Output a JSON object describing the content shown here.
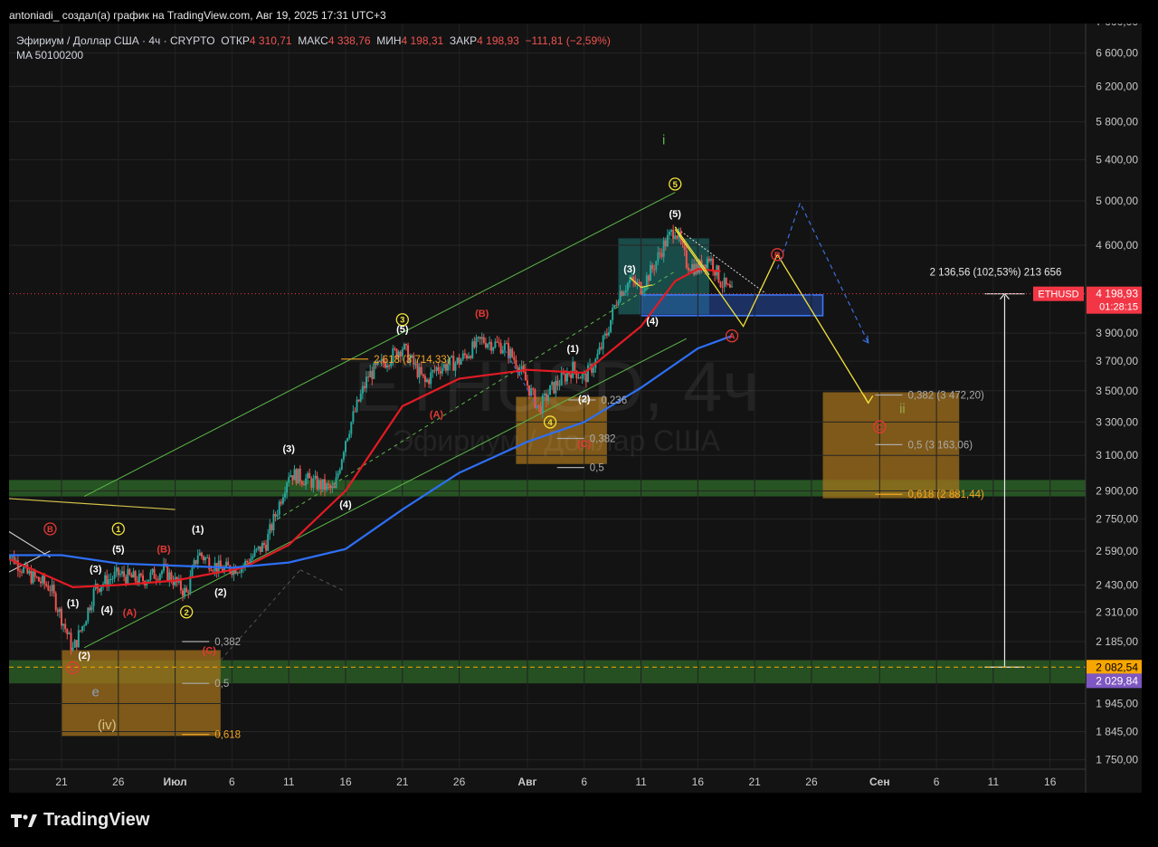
{
  "topline": "antoniadi_ создал(а) график на TradingView.com, Авг 19, 2025 17:31 UTC+3",
  "legend": {
    "symbol": "Эфириум / Доллар США · 4ч · CRYPTO",
    "open_label": "ОТКР",
    "open": "4 310,71",
    "high_label": "МАКС",
    "high": "4 338,76",
    "low_label": "МИН",
    "low": "4 198,31",
    "close_label": "ЗАКР",
    "close": "4 198,93",
    "change": "−111,81 (−2,59%)",
    "indicator": "MA 50100200"
  },
  "watermark": {
    "ticker": "ETHUSD, 4ч",
    "name": "Эфириум / Доллар США"
  },
  "brand": "TradingView",
  "colors": {
    "ma_red": "#e31b23",
    "ma_blue": "#2d6ff5",
    "channel": "#5cb84a",
    "wave_yellow": "#f2e33a",
    "zone_orange": "#a8751c",
    "zone_green": "#2f6b2a",
    "price_badge": "#f23645",
    "low_badge": "#7e57c2"
  },
  "chart_data": {
    "type": "candlestick",
    "scale": "log",
    "symbol": "ETHUSD",
    "timeframe": "4ч",
    "price_axis_ticks": [
      "7 000,00",
      "6 600,00",
      "6 200,00",
      "5 800,00",
      "5 400,00",
      "5 000,00",
      "4 600,00",
      "3 900,00",
      "3 700,00",
      "3 500,00",
      "3 300,00",
      "3 100,00",
      "2 900,00",
      "2 750,00",
      "2 590,00",
      "2 430,00",
      "2 310,00",
      "2 185,00",
      "1 945,00",
      "1 845,00",
      "1 750,00"
    ],
    "price_axis_values": [
      7000,
      6600,
      6200,
      5800,
      5400,
      5000,
      4600,
      3900,
      3700,
      3500,
      3300,
      3100,
      2900,
      2750,
      2590,
      2430,
      2310,
      2185,
      1945,
      1845,
      1750
    ],
    "time_axis": [
      {
        "label": "21",
        "date": "2025-06-21"
      },
      {
        "label": "26",
        "date": "2025-06-26"
      },
      {
        "label": "Июл",
        "date": "2025-07-01"
      },
      {
        "label": "6",
        "date": "2025-07-06"
      },
      {
        "label": "11",
        "date": "2025-07-11"
      },
      {
        "label": "16",
        "date": "2025-07-16"
      },
      {
        "label": "21",
        "date": "2025-07-21"
      },
      {
        "label": "26",
        "date": "2025-07-26"
      },
      {
        "label": "Авг",
        "date": "2025-08-01"
      },
      {
        "label": "6",
        "date": "2025-08-06"
      },
      {
        "label": "11",
        "date": "2025-08-11"
      },
      {
        "label": "16",
        "date": "2025-08-16"
      },
      {
        "label": "21",
        "date": "2025-08-21"
      },
      {
        "label": "26",
        "date": "2025-08-26"
      },
      {
        "label": "Сен",
        "date": "2025-09-01"
      },
      {
        "label": "6",
        "date": "2025-09-06"
      },
      {
        "label": "11",
        "date": "2025-09-11"
      },
      {
        "label": "16",
        "date": "2025-09-16"
      }
    ],
    "price_path": [
      {
        "date": "2025-06-16",
        "close": 2600
      },
      {
        "date": "2025-06-18",
        "close": 2480
      },
      {
        "date": "2025-06-20",
        "close": 2420
      },
      {
        "date": "2025-06-22",
        "close": 2150
      },
      {
        "date": "2025-06-23",
        "close": 2270
      },
      {
        "date": "2025-06-24",
        "close": 2420
      },
      {
        "date": "2025-06-26",
        "close": 2480
      },
      {
        "date": "2025-06-28",
        "close": 2450
      },
      {
        "date": "2025-06-30",
        "close": 2500
      },
      {
        "date": "2025-07-02",
        "close": 2390
      },
      {
        "date": "2025-07-03",
        "close": 2580
      },
      {
        "date": "2025-07-05",
        "close": 2500
      },
      {
        "date": "2025-07-07",
        "close": 2520
      },
      {
        "date": "2025-07-09",
        "close": 2630
      },
      {
        "date": "2025-07-10",
        "close": 2800
      },
      {
        "date": "2025-07-11",
        "close": 3000
      },
      {
        "date": "2025-07-13",
        "close": 2950
      },
      {
        "date": "2025-07-15",
        "close": 2900
      },
      {
        "date": "2025-07-16",
        "close": 3200
      },
      {
        "date": "2025-07-17",
        "close": 3400
      },
      {
        "date": "2025-07-18",
        "close": 3600
      },
      {
        "date": "2025-07-21",
        "close": 3800
      },
      {
        "date": "2025-07-23",
        "close": 3550
      },
      {
        "date": "2025-07-24",
        "close": 3650
      },
      {
        "date": "2025-07-26",
        "close": 3700
      },
      {
        "date": "2025-07-28",
        "close": 3850
      },
      {
        "date": "2025-07-30",
        "close": 3800
      },
      {
        "date": "2025-07-31",
        "close": 3700
      },
      {
        "date": "2025-08-02",
        "close": 3380
      },
      {
        "date": "2025-08-03",
        "close": 3500
      },
      {
        "date": "2025-08-05",
        "close": 3650
      },
      {
        "date": "2025-08-06",
        "close": 3580
      },
      {
        "date": "2025-08-07",
        "close": 3700
      },
      {
        "date": "2025-08-08",
        "close": 3900
      },
      {
        "date": "2025-08-09",
        "close": 4200
      },
      {
        "date": "2025-08-10",
        "close": 4300
      },
      {
        "date": "2025-08-11",
        "close": 4250
      },
      {
        "date": "2025-08-12",
        "close": 4400
      },
      {
        "date": "2025-08-13",
        "close": 4600
      },
      {
        "date": "2025-08-14",
        "close": 4750
      },
      {
        "date": "2025-08-15",
        "close": 4450
      },
      {
        "date": "2025-08-16",
        "close": 4400
      },
      {
        "date": "2025-08-17",
        "close": 4500
      },
      {
        "date": "2025-08-18",
        "close": 4300
      },
      {
        "date": "2025-08-19",
        "close": 4198.93
      }
    ],
    "moving_averages": [
      {
        "name": "MA 50",
        "color": "#e31b23",
        "points": [
          {
            "date": "2025-06-16",
            "value": 2560
          },
          {
            "date": "2025-06-22",
            "value": 2420
          },
          {
            "date": "2025-06-26",
            "value": 2430
          },
          {
            "date": "2025-07-01",
            "value": 2450
          },
          {
            "date": "2025-07-07",
            "value": 2510
          },
          {
            "date": "2025-07-11",
            "value": 2620
          },
          {
            "date": "2025-07-16",
            "value": 2900
          },
          {
            "date": "2025-07-21",
            "value": 3400
          },
          {
            "date": "2025-07-26",
            "value": 3580
          },
          {
            "date": "2025-08-01",
            "value": 3640
          },
          {
            "date": "2025-08-06",
            "value": 3620
          },
          {
            "date": "2025-08-11",
            "value": 3950
          },
          {
            "date": "2025-08-14",
            "value": 4300
          },
          {
            "date": "2025-08-16",
            "value": 4400
          },
          {
            "date": "2025-08-18",
            "value": 4380
          }
        ]
      },
      {
        "name": "MA 200",
        "color": "#2d6ff5",
        "points": [
          {
            "date": "2025-06-16",
            "value": 2570
          },
          {
            "date": "2025-06-21",
            "value": 2570
          },
          {
            "date": "2025-06-26",
            "value": 2530
          },
          {
            "date": "2025-07-01",
            "value": 2520
          },
          {
            "date": "2025-07-06",
            "value": 2510
          },
          {
            "date": "2025-07-11",
            "value": 2535
          },
          {
            "date": "2025-07-16",
            "value": 2600
          },
          {
            "date": "2025-07-21",
            "value": 2800
          },
          {
            "date": "2025-07-26",
            "value": 3000
          },
          {
            "date": "2025-08-01",
            "value": 3180
          },
          {
            "date": "2025-08-06",
            "value": 3300
          },
          {
            "date": "2025-08-11",
            "value": 3520
          },
          {
            "date": "2025-08-16",
            "value": 3790
          },
          {
            "date": "2025-08-19",
            "value": 3880
          }
        ]
      }
    ],
    "price_badges": [
      {
        "label": "ETHUSD",
        "value": "4 198,93",
        "timer": "01:28:15",
        "price": 4198.93,
        "color": "#f23645"
      },
      {
        "value": "2 082,54",
        "price": 2082.54,
        "color": "#f7a600"
      },
      {
        "value": "2 029,84",
        "price": 2029.84,
        "color": "#7e57c2"
      }
    ],
    "measure": {
      "text": "2 136,56 (102,53%) 213 656",
      "from_price": 2082.54,
      "to_price": 4198.93,
      "date": "2025-09-12"
    },
    "fib_levels": [
      {
        "text": "2,618 (3 714,33)",
        "price": 3714.33,
        "date": "2025-07-18",
        "color": "#f5a623"
      },
      {
        "text": "0,236",
        "price": 3440,
        "date": "2025-08-07",
        "color": "#aaaaaa"
      },
      {
        "text": "0,382",
        "price": 3200,
        "date": "2025-08-06",
        "color": "#aaaaaa"
      },
      {
        "text": "0,5",
        "price": 3030,
        "date": "2025-08-06",
        "color": "#aaaaaa"
      },
      {
        "text": "0,382",
        "price": 2185,
        "date": "2025-07-04",
        "color": "#aaaaaa"
      },
      {
        "text": "0,5",
        "price": 2020,
        "date": "2025-07-04",
        "color": "#aaaaaa"
      },
      {
        "text": "0,618",
        "price": 1835,
        "date": "2025-07-04",
        "color": "#f5a623"
      },
      {
        "text": "0,382 (3 472,20)",
        "price": 3472.2,
        "date": "2025-09-03",
        "color": "#aaaaaa"
      },
      {
        "text": "0,5 (3 163,06)",
        "price": 3163.06,
        "date": "2025-09-03",
        "color": "#aaaaaa"
      },
      {
        "text": "0,618 (2 881,44)",
        "price": 2881.44,
        "date": "2025-09-03",
        "color": "#f5a623"
      }
    ],
    "wave_labels": [
      {
        "text": "i",
        "date": "2025-08-13",
        "price": 5600,
        "color": "#5cb84a",
        "circle": false
      },
      {
        "text": "5",
        "date": "2025-08-14",
        "price": 5160,
        "color": "#f2e33a",
        "circle": true
      },
      {
        "text": "(5)",
        "date": "2025-08-14",
        "price": 4880,
        "color": "#ffffff",
        "circle": false
      },
      {
        "text": "(3)",
        "date": "2025-08-10",
        "price": 4400,
        "color": "#ffffff",
        "circle": false
      },
      {
        "text": "(4)",
        "date": "2025-08-12",
        "price": 3990,
        "color": "#ffffff",
        "circle": false
      },
      {
        "text": "B",
        "date": "2025-08-23",
        "price": 4520,
        "color": "#e53935",
        "circle": true
      },
      {
        "text": "A",
        "date": "2025-08-19",
        "price": 3880,
        "color": "#e53935",
        "circle": true
      },
      {
        "text": "ii",
        "date": "2025-09-03",
        "price": 3380,
        "color": "#9aa84a",
        "circle": false
      },
      {
        "text": "C",
        "date": "2025-09-01",
        "price": 3270,
        "color": "#e53935",
        "circle": true
      },
      {
        "text": "(B)",
        "date": "2025-07-28",
        "price": 4050,
        "color": "#e53935",
        "circle": false
      },
      {
        "text": "3",
        "date": "2025-07-21",
        "price": 4000,
        "color": "#f2e33a",
        "circle": true
      },
      {
        "text": "(5)",
        "date": "2025-07-21",
        "price": 3930,
        "color": "#ffffff",
        "circle": false
      },
      {
        "text": "(A)",
        "date": "2025-07-24",
        "price": 3350,
        "color": "#e53935",
        "circle": false
      },
      {
        "text": "(1)",
        "date": "2025-08-05",
        "price": 3790,
        "color": "#ffffff",
        "circle": false
      },
      {
        "text": "(2)",
        "date": "2025-08-06",
        "price": 3450,
        "color": "#ffffff",
        "circle": false
      },
      {
        "text": "4",
        "date": "2025-08-03",
        "price": 3300,
        "color": "#f2e33a",
        "circle": true
      },
      {
        "text": "(C)",
        "date": "2025-08-06",
        "price": 3170,
        "color": "#e53935",
        "circle": false
      },
      {
        "text": "(3)",
        "date": "2025-07-11",
        "price": 3140,
        "color": "#ffffff",
        "circle": false
      },
      {
        "text": "(4)",
        "date": "2025-07-16",
        "price": 2830,
        "color": "#ffffff",
        "circle": false
      },
      {
        "text": "B",
        "date": "2025-06-20",
        "price": 2700,
        "color": "#e53935",
        "circle": true
      },
      {
        "text": "1",
        "date": "2025-06-26",
        "price": 2700,
        "color": "#f2e33a",
        "circle": true
      },
      {
        "text": "(5)",
        "date": "2025-06-26",
        "price": 2600,
        "color": "#ffffff",
        "circle": false
      },
      {
        "text": "(B)",
        "date": "2025-06-30",
        "price": 2600,
        "color": "#e53935",
        "circle": false
      },
      {
        "text": "(1)",
        "date": "2025-07-03",
        "price": 2700,
        "color": "#ffffff",
        "circle": false
      },
      {
        "text": "(3)",
        "date": "2025-06-24",
        "price": 2505,
        "color": "#ffffff",
        "circle": false
      },
      {
        "text": "(2)",
        "date": "2025-07-05",
        "price": 2400,
        "color": "#ffffff",
        "circle": false
      },
      {
        "text": "(1)",
        "date": "2025-06-22",
        "price": 2350,
        "color": "#ffffff",
        "circle": false
      },
      {
        "text": "(4)",
        "date": "2025-06-25",
        "price": 2320,
        "color": "#ffffff",
        "circle": false
      },
      {
        "text": "(A)",
        "date": "2025-06-27",
        "price": 2310,
        "color": "#e53935",
        "circle": false
      },
      {
        "text": "2",
        "date": "2025-07-02",
        "price": 2310,
        "color": "#f2e33a",
        "circle": true
      },
      {
        "text": "(C)",
        "date": "2025-07-04",
        "price": 2150,
        "color": "#e53935",
        "circle": false
      },
      {
        "text": "(2)",
        "date": "2025-06-23",
        "price": 2130,
        "color": "#ffffff",
        "circle": false
      },
      {
        "text": "C",
        "date": "2025-06-22",
        "price": 2080,
        "color": "#e53935",
        "circle": true
      },
      {
        "text": "e",
        "date": "2025-06-24",
        "price": 1985,
        "color": "#8aa0c0",
        "circle": false
      },
      {
        "text": "(iv)",
        "date": "2025-06-25",
        "price": 1865,
        "color": "#d9c28a",
        "circle": false
      }
    ]
  }
}
